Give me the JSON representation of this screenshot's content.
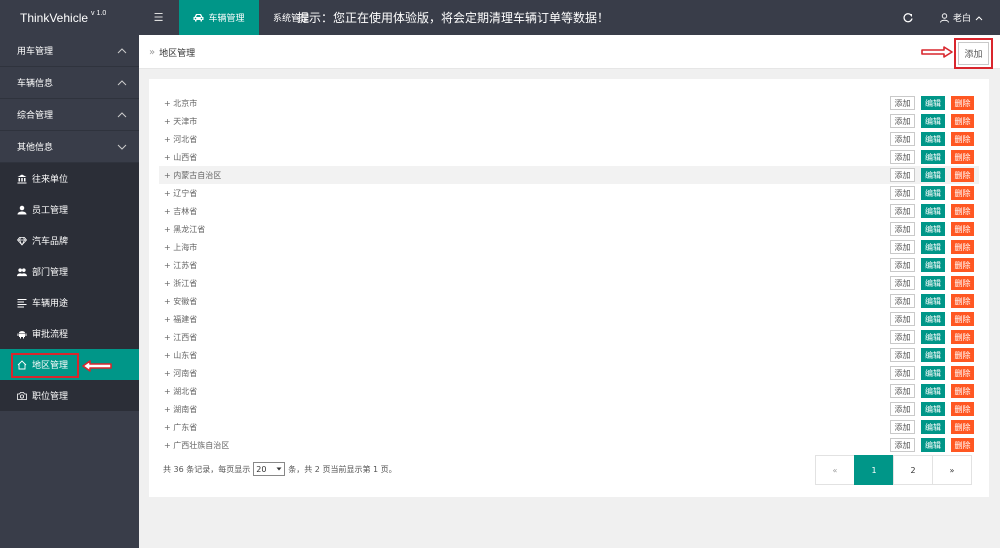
{
  "brand": {
    "name": "ThinkVehicle",
    "version": "v 1.0"
  },
  "topnav": {
    "menu_toggle_glyph": "☰",
    "active_tab": "车辆管理",
    "system_tab": "系统管理",
    "notice": "提示：您正在使用体验版，将会定期清理车辆订单等数据！",
    "user": "老白"
  },
  "sidebar": {
    "groups": [
      {
        "label": "用车管理",
        "expanded": false
      },
      {
        "label": "车辆信息",
        "expanded": false
      },
      {
        "label": "综合管理",
        "expanded": false
      },
      {
        "label": "其他信息",
        "expanded": true
      }
    ],
    "items": [
      {
        "label": "往来单位",
        "icon": "bank-icon"
      },
      {
        "label": "员工管理",
        "icon": "user-icon"
      },
      {
        "label": "汽车品牌",
        "icon": "diamond-icon"
      },
      {
        "label": "部门管理",
        "icon": "users-icon"
      },
      {
        "label": "车辆用途",
        "icon": "list-icon"
      },
      {
        "label": "审批流程",
        "icon": "android-icon"
      },
      {
        "label": "地区管理",
        "icon": "home-icon",
        "active": true
      },
      {
        "label": "职位管理",
        "icon": "camera-icon"
      }
    ]
  },
  "breadcrumb": {
    "current": "地区管理",
    "add_label": "添加"
  },
  "actions": {
    "add": "添加",
    "edit": "编辑",
    "delete": "删除"
  },
  "regions": [
    "+ 北京市",
    "+ 天津市",
    "+ 河北省",
    "+ 山西省",
    "+ 内蒙古自治区",
    "+ 辽宁省",
    "+ 吉林省",
    "+ 黑龙江省",
    "+ 上海市",
    "+ 江苏省",
    "+ 浙江省",
    "+ 安徽省",
    "+ 福建省",
    "+ 江西省",
    "+ 山东省",
    "+ 河南省",
    "+ 湖北省",
    "+ 湖南省",
    "+ 广东省",
    "+ 广西壮族自治区"
  ],
  "pagination": {
    "total_prefix": "共 36 条记录，每页显示",
    "page_size": "20",
    "suffix": "条，共 2 页当前显示第 1 页。",
    "prev": "«",
    "pages": [
      "1",
      "2"
    ],
    "next": "»",
    "current": "1"
  },
  "colors": {
    "accent": "#009688",
    "danger": "#ff5722",
    "sidebar": "#393d49",
    "highlight": "#d9262d"
  }
}
